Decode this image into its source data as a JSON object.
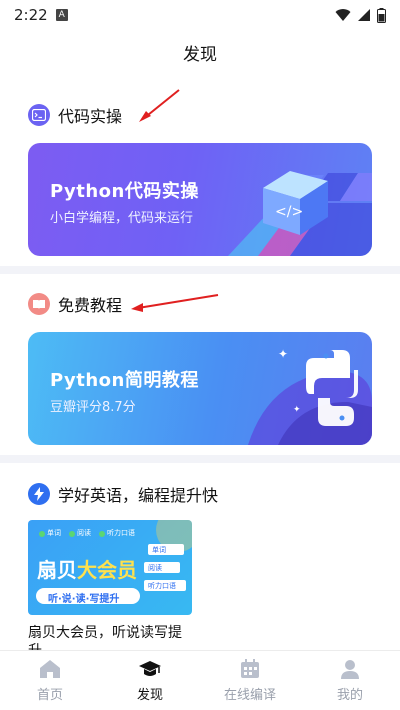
{
  "status": {
    "time": "2:22",
    "notif_glyph": "A"
  },
  "header": {
    "title": "发现"
  },
  "sections": [
    {
      "title": "代码实操",
      "icon": "terminal-icon",
      "banner": {
        "title": "Python代码实操",
        "subtitle": "小白学编程，代码来运行"
      }
    },
    {
      "title": "免费教程",
      "icon": "book-icon",
      "banner": {
        "title": "Python简明教程",
        "subtitle": "豆瓣评分8.7分"
      }
    },
    {
      "title": "学好英语，编程提升快",
      "icon": "lightning-icon",
      "card": {
        "tags": [
          "单词",
          "阅读",
          "听力口语"
        ],
        "side_tags": [
          "单词",
          "阅读",
          "听力口语"
        ],
        "headline_a": "扇贝",
        "headline_b": "大会员",
        "pill": "听·说·读·写提升",
        "caption_line1": "扇贝大会员，听说读写提",
        "caption_line2": "升"
      }
    }
  ],
  "tabs": [
    {
      "label": "首页",
      "icon": "home-icon",
      "active": false
    },
    {
      "label": "发现",
      "icon": "graduation-cap-icon",
      "active": true
    },
    {
      "label": "在线编译",
      "icon": "calendar-icon",
      "active": false
    },
    {
      "label": "我的",
      "icon": "person-icon",
      "active": false
    }
  ],
  "colors": {
    "accent_purple": "#6b63f2",
    "accent_blue": "#2f6ff0",
    "annotation_red": "#e02020",
    "tab_inactive": "#9aa0ac"
  }
}
